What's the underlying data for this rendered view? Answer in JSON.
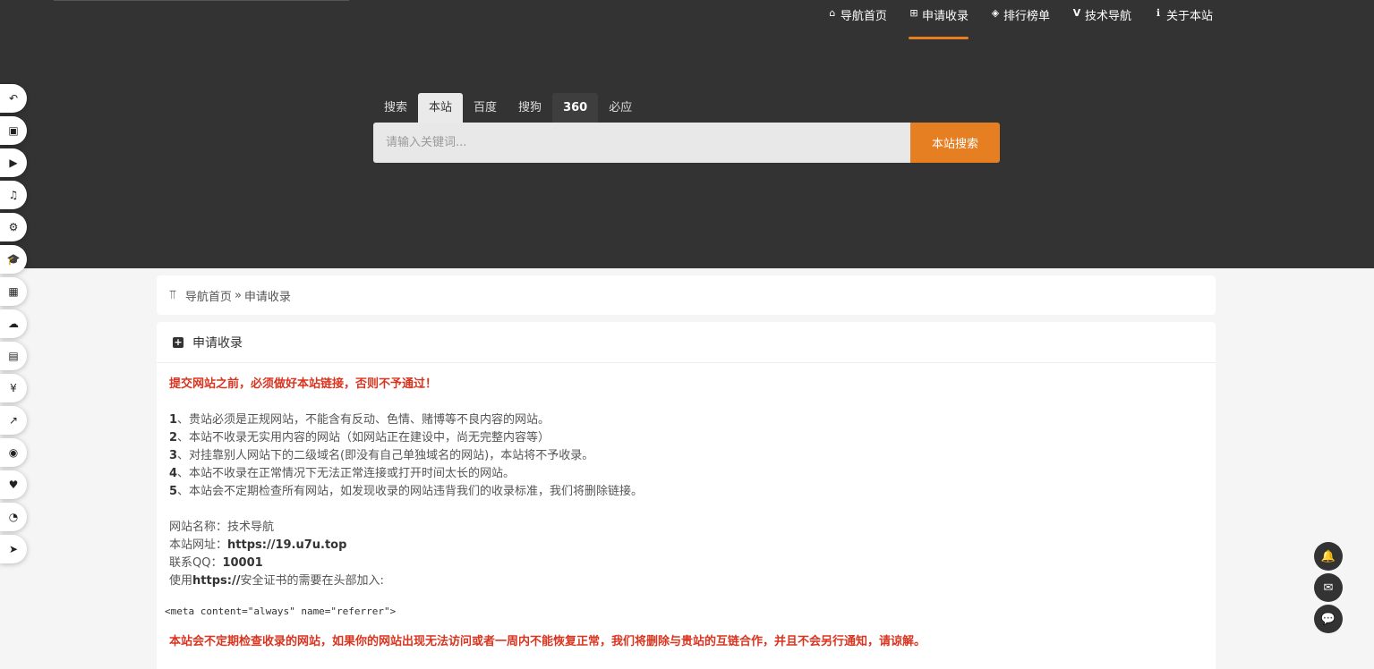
{
  "header": {
    "nav": [
      {
        "icon": "home-icon",
        "glyph": "⌂",
        "label": "导航首页"
      },
      {
        "icon": "plus-square-icon",
        "glyph": "⊞",
        "label": "申请收录",
        "active": true
      },
      {
        "icon": "ranking-icon",
        "glyph": "◈",
        "label": "排行榜单"
      },
      {
        "icon": "v-logo-icon",
        "glyph": "V",
        "label": "技术导航"
      },
      {
        "icon": "info-icon",
        "glyph": "ℹ",
        "label": "关于本站"
      }
    ]
  },
  "search": {
    "tabs": [
      "搜索",
      "本站",
      "百度",
      "搜狗",
      "360",
      "必应"
    ],
    "placeholder": "请输入关键词...",
    "button": "本站搜索"
  },
  "sidebar": {
    "icons": [
      "undo-icon",
      "bus-icon",
      "youtube-icon",
      "music-icon",
      "bicycle-icon",
      "graduation-cap-icon",
      "grid-icon",
      "cloud-icon",
      "document-icon",
      "yen-icon",
      "chart-line-icon",
      "compass-icon",
      "heartbeat-icon",
      "edge-browser-icon",
      "paper-plane-icon"
    ],
    "glyphs": [
      "↶",
      "▣",
      "▶",
      "♫",
      "⚙",
      "🎓",
      "▦",
      "☁",
      "▤",
      "¥",
      "↗",
      "◉",
      "♥",
      "◔",
      "➤"
    ]
  },
  "breadcrumb": {
    "icon": "branch-icon",
    "home": "导航首页",
    "separator": "»",
    "current": "申请收录"
  },
  "card": {
    "title": "申请收录",
    "warning": "提交网站之前，必须做好本站链接，否则不予通过！",
    "rules": [
      {
        "num": "1",
        "text": "、贵站必须是正规网站，不能含有反动、色情、赌博等不良内容的网站。"
      },
      {
        "num": "2",
        "text": "、本站不收录无实用内容的网站（如网站正在建设中，尚无完整内容等）"
      },
      {
        "num": "3",
        "text": "、对挂靠别人网站下的二级域名(即没有自己单独域名的网站)，本站将不予收录。"
      },
      {
        "num": "4",
        "text": "、本站不收录在正常情况下无法正常连接或打开时间太长的网站。"
      },
      {
        "num": "5",
        "text": "、本站会不定期检查所有网站，如发现收录的网站违背我们的收录标准，我们将删除链接。"
      }
    ],
    "site_name_label": "网站名称：",
    "site_name": "技术导航",
    "site_url_label": "本站网址：",
    "site_url": "https://19.u7u.top",
    "qq_label": "联系QQ：",
    "qq": "10001",
    "https_prefix": "使用",
    "https_bold": "https://",
    "https_suffix": "安全证书的需要在头部加入:",
    "code": "<meta content=\"always\" name=\"referrer\">",
    "final_warning": "本站会不定期检查收录的网站，如果你的网站出现无法访问或者一周内不能恢复正常，我们将删除与贵站的互链合作，并且不会另行通知，请谅解。"
  },
  "float_buttons": {
    "icons": [
      "bell-icon",
      "mail-icon",
      "wechat-icon"
    ],
    "glyphs": [
      "🔔",
      "✉",
      "💬"
    ]
  },
  "colors": {
    "hero_bg": "#333333",
    "accent": "#e67e22",
    "warning": "#d9341f"
  }
}
